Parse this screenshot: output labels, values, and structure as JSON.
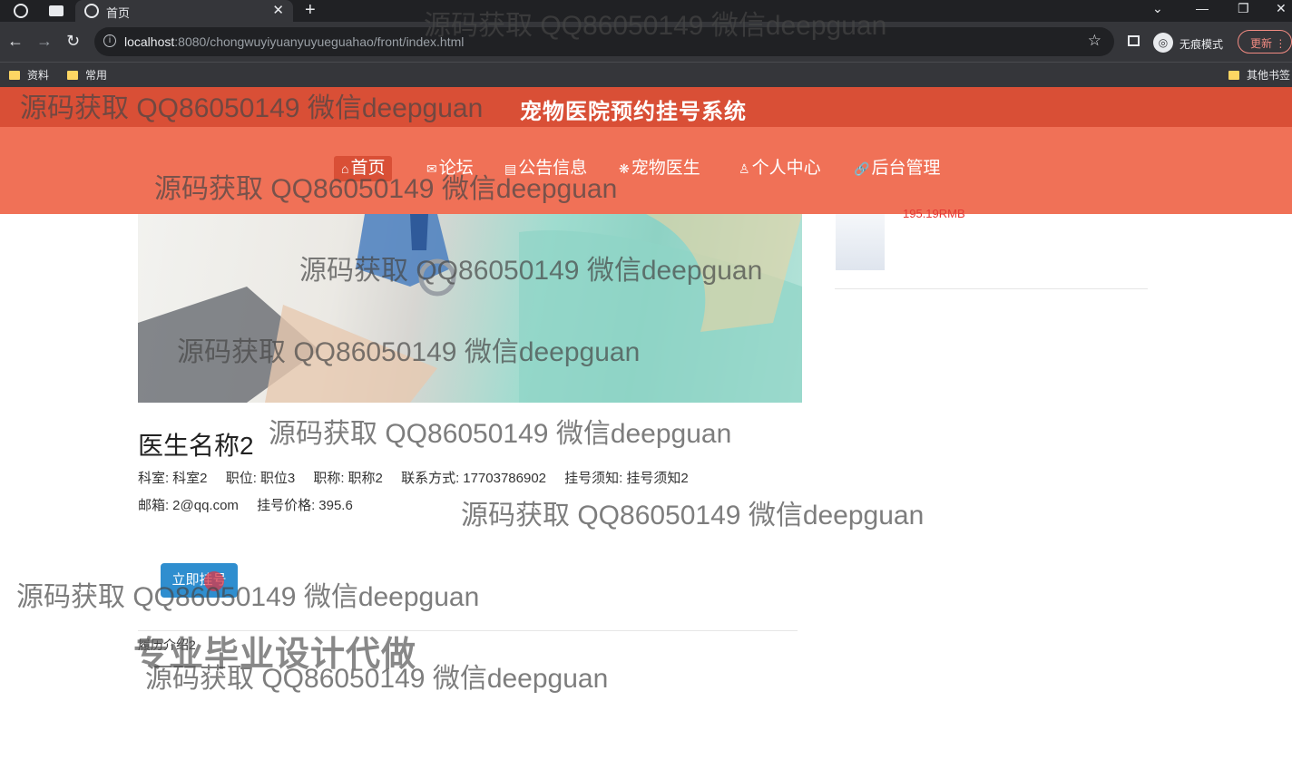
{
  "browser": {
    "tab_title": "首页",
    "tab_close": "✕",
    "new_tab": "+",
    "url_host": "localhost",
    "url_rest": ":8080/chongwuyiyuanyuyueguahao/front/index.html",
    "incognito_label": "无痕模式",
    "update_label": "更新",
    "bookmarks": [
      "资料",
      "常用",
      "其他书签"
    ]
  },
  "site": {
    "title": "宠物医院预约挂号系统",
    "nav": [
      {
        "label": "首页",
        "icon": "⌂"
      },
      {
        "label": "论坛",
        "icon": "✉"
      },
      {
        "label": "公告信息",
        "icon": "▤"
      },
      {
        "label": "宠物医生",
        "icon": "❋"
      },
      {
        "label": "个人中心",
        "icon": "♙"
      },
      {
        "label": "后台管理",
        "icon": "🔗"
      }
    ],
    "nav_active": "首页"
  },
  "sidebar": {
    "price_partial": "195.19RMB"
  },
  "doctor": {
    "name": "医生名称2",
    "row1": [
      {
        "label": "科室:",
        "value": "科室2"
      },
      {
        "label": "职位:",
        "value": "职位3"
      },
      {
        "label": "职称:",
        "value": "职称2"
      },
      {
        "label": "联系方式:",
        "value": "17703786902"
      },
      {
        "label": "挂号须知:",
        "value": "挂号须知2"
      }
    ],
    "row2": [
      {
        "label": "邮箱:",
        "value": "2@qq.com"
      },
      {
        "label": "挂号价格:",
        "value": "395.6"
      }
    ],
    "book_button": "立即挂号",
    "intro": "履历介绍2"
  },
  "overlay": {
    "watermark": "源码获取 QQ86050149 微信deepguan",
    "promo": "专业毕业设计代做"
  },
  "colors": {
    "header_dark": "#d94f36",
    "nav_bar": "#f07157",
    "button": "#2f8ecf",
    "price": "#e53935"
  }
}
